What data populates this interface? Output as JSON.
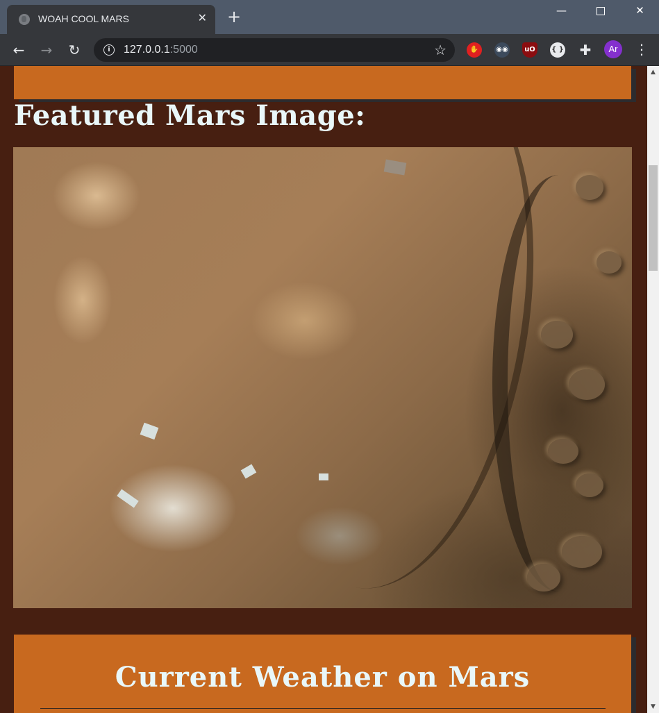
{
  "browser": {
    "tab_title": "WOAH COOL MARS",
    "tab_close_glyph": "✕",
    "new_tab_glyph": "+",
    "url_host": "127.0.0.1",
    "url_port": ":5000",
    "profile_initials": "Ar",
    "window_controls": {
      "minimize": "—",
      "close": "✕"
    },
    "nav": {
      "back": "←",
      "forward": "→",
      "reload": "↻"
    },
    "star_glyph": "☆",
    "menu_glyph": "⋮",
    "extensions": [
      {
        "icon": "stop-hand-icon",
        "glyph": "✋"
      },
      {
        "icon": "spy-icon",
        "glyph": "◉◉"
      },
      {
        "icon": "ublock-icon",
        "glyph": "uO"
      },
      {
        "icon": "json-viewer-icon",
        "glyph": "{ }"
      },
      {
        "icon": "puzzle-icon",
        "glyph": "✚"
      }
    ]
  },
  "page": {
    "featured_title": "Featured Mars Image:",
    "weather_title": "Current Weather on Mars"
  },
  "colors": {
    "page_background": "#471f11",
    "card_orange": "#c8691f",
    "heading_text": "#e9f7f9",
    "profile_purple": "#8430ce"
  }
}
